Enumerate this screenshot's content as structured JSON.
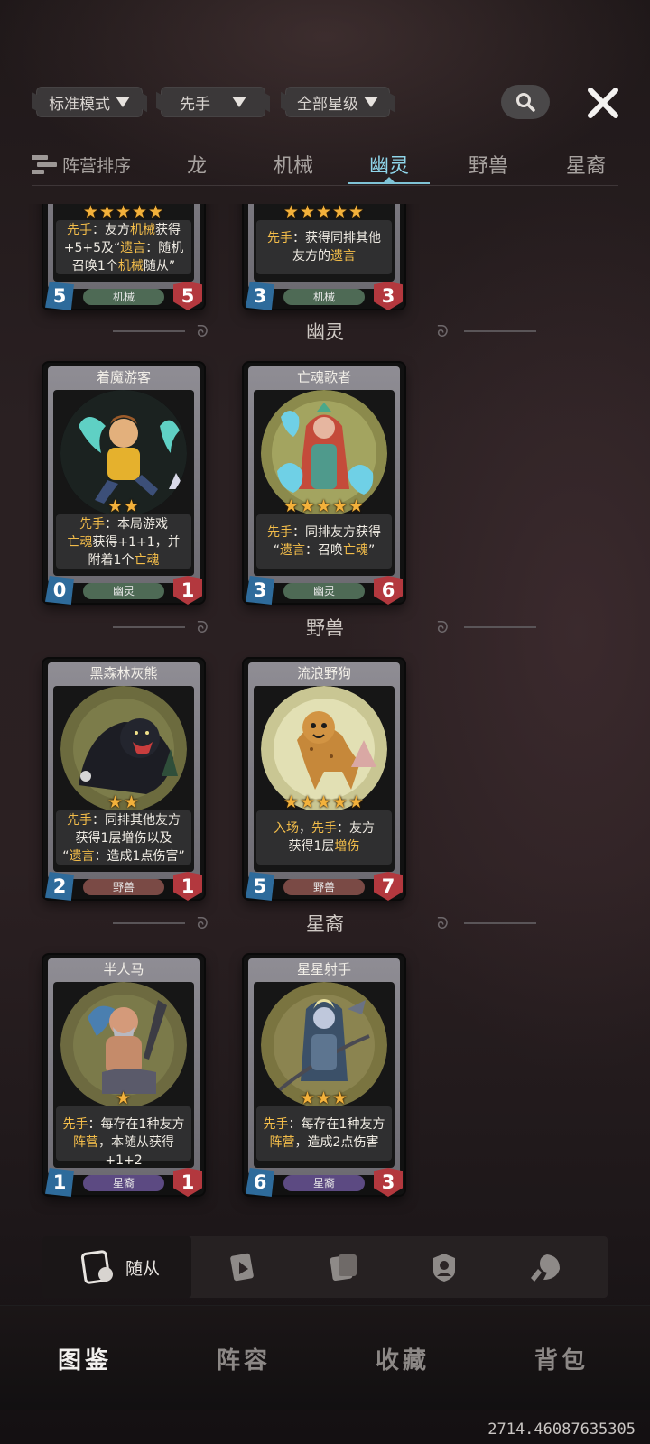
{
  "filters": [
    {
      "label": "标准模式"
    },
    {
      "label": "先手"
    },
    {
      "label": "全部星级"
    }
  ],
  "tabs": {
    "sort_label": "阵营排序",
    "items": [
      "龙",
      "机械",
      "幽灵",
      "野兽",
      "星裔"
    ],
    "active": "幽灵"
  },
  "top_cards": [
    {
      "stars": "★★★★★",
      "desc_html": "<span class='hl'>先手</span>：友方<span class='hl'>机械</span>获得<br>+5+5及“<span class='hl'>遗言</span>：随机<br>召唤1个<span class='hl'>机械</span>随从”",
      "atk": "5",
      "hp": "5",
      "tribe": "机械"
    },
    {
      "stars": "★★★★★",
      "desc_html": "<span class='hl'>先手</span>：获得同排其他<br>友方的<span class='hl'>遗言</span>",
      "atk": "3",
      "hp": "3",
      "tribe": "机械"
    }
  ],
  "sections": [
    {
      "title": "幽灵",
      "cards": [
        {
          "name": "着魔游客",
          "stars": "★★",
          "desc_html": "<span class='hl'>先手</span>：本局游戏<br><span class='hl'>亡魂</span>获得+1+1，并<br>附着1个<span class='hl'>亡魂</span>",
          "atk": "0",
          "hp": "1",
          "tribe": "幽灵",
          "tribe_class": "ghost"
        },
        {
          "name": "亡魂歌者",
          "stars": "★★★★★",
          "desc_html": "<span class='hl'>先手</span>：同排友方获得<br>“<span class='hl'>遗言</span>：召唤<span class='hl'>亡魂</span>”",
          "atk": "3",
          "hp": "6",
          "tribe": "幽灵",
          "tribe_class": "ghost"
        }
      ]
    },
    {
      "title": "野兽",
      "cards": [
        {
          "name": "黑森林灰熊",
          "stars": "★★",
          "desc_html": "<span class='hl'>先手</span>：同排其他友方<br>获得1层增伤以及<br>“<span class='hl'>遗言</span>：造成1点伤害”",
          "atk": "2",
          "hp": "1",
          "tribe": "野兽",
          "tribe_class": "beast"
        },
        {
          "name": "流浪野狗",
          "stars": "★★★★★",
          "desc_html": "<span class='hl'>入场</span>，<span class='hl'>先手</span>：友方<br>获得1层<span class='hl'>增伤</span>",
          "atk": "5",
          "hp": "7",
          "tribe": "野兽",
          "tribe_class": "beast"
        }
      ]
    },
    {
      "title": "星裔",
      "cards": [
        {
          "name": "半人马",
          "stars": "★",
          "desc_html": "<span class='hl'>先手</span>：每存在1种友方<br><span class='hl'>阵营</span>，本随从获得+1+2",
          "atk": "1",
          "hp": "1",
          "tribe": "星裔",
          "tribe_class": "star"
        },
        {
          "name": "星星射手",
          "stars": "★★★",
          "desc_html": "<span class='hl'>先手</span>：每存在1种友方<br><span class='hl'>阵营</span>，造成2点伤害",
          "atk": "6",
          "hp": "3",
          "tribe": "星裔",
          "tribe_class": "star"
        }
      ]
    }
  ],
  "subnav": {
    "active_label": "随从"
  },
  "bottom_nav": {
    "items": [
      "图鉴",
      "阵容",
      "收藏",
      "背包"
    ],
    "active": "图鉴"
  },
  "corner_text": "2714.46087635305",
  "colors": {
    "accent": "#8fd6ea",
    "highlight": "#f3bd4a",
    "star": "#f3b13b",
    "attack": "#2e6b9b",
    "health": "#b3383e"
  }
}
